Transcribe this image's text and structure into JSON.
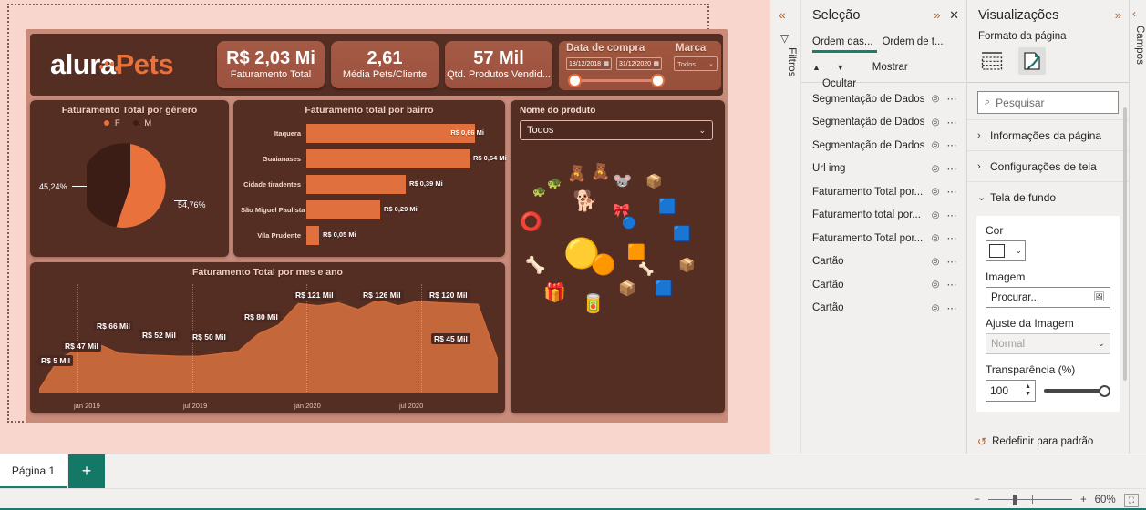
{
  "report": {
    "brand": {
      "name_left": "alura",
      "name_right": "Pets"
    },
    "kpis": [
      {
        "value": "R$ 2,03 Mi",
        "label": "Faturamento Total"
      },
      {
        "value": "2,61",
        "label": "Média Pets/Cliente"
      },
      {
        "value": "57 Mil",
        "label": "Qtd. Produtos Vendid..."
      }
    ],
    "slicers": {
      "date_title": "Data de compra",
      "date_start": "18/12/2018",
      "date_end": "31/12/2020",
      "brand_title": "Marca",
      "brand_value": "Todos"
    },
    "gallery": {
      "title": "Nome do produto",
      "selected": "Todos"
    }
  },
  "chart_data": [
    {
      "type": "pie",
      "title": "Faturamento Total por gênero",
      "legend": [
        "F",
        "M"
      ],
      "legend_position": "top",
      "categories": [
        "F",
        "M"
      ],
      "values": [
        54.76,
        45.24
      ],
      "labels": [
        "54,76%",
        "45,24%"
      ],
      "colors": [
        "#e8713c",
        "#3b1d16"
      ]
    },
    {
      "type": "bar",
      "title": "Faturamento total por bairro",
      "orientation": "horizontal",
      "categories": [
        "Itaquera",
        "Guaianases",
        "Cidade tiradentes",
        "São Miguel Paulista",
        "Vila Prudente"
      ],
      "values": [
        0.66,
        0.64,
        0.39,
        0.29,
        0.05
      ],
      "labels": [
        "R$ 0,66 Mi",
        "R$ 0,64 Mi",
        "R$ 0,39 Mi",
        "R$ 0,29 Mi",
        "R$ 0,05 Mi"
      ],
      "xlabel": "",
      "ylabel": "",
      "xlim": [
        0,
        0.7
      ],
      "color": "#e0713f"
    },
    {
      "type": "area",
      "title": "Faturamento Total por mes e ano",
      "xlabel": "",
      "ylabel": "",
      "x_ticks": [
        "jan 2019",
        "jul 2019",
        "jan 2020",
        "jul 2020"
      ],
      "ylim": [
        0,
        135
      ],
      "grid": true,
      "color": "#d26a38",
      "labeled_points": [
        {
          "label": "R$ 5 Mil",
          "value": 5
        },
        {
          "label": "R$ 47 Mil",
          "value": 47
        },
        {
          "label": "R$ 66 Mil",
          "value": 66
        },
        {
          "label": "R$ 52 Mil",
          "value": 52
        },
        {
          "label": "R$ 50 Mil",
          "value": 50
        },
        {
          "label": "R$ 80 Mil",
          "value": 80
        },
        {
          "label": "R$ 121 Mil",
          "value": 121
        },
        {
          "label": "R$ 126 Mil",
          "value": 126
        },
        {
          "label": "R$ 120 Mil",
          "value": 120
        },
        {
          "label": "R$ 45 Mil",
          "value": 45
        }
      ],
      "values": [
        5,
        47,
        60,
        66,
        54,
        52,
        51,
        50,
        50,
        53,
        57,
        80,
        92,
        121,
        118,
        122,
        113,
        126,
        118,
        124,
        122,
        121,
        120,
        45
      ]
    }
  ],
  "filters_rail": {
    "label": "Filtros",
    "collapse_icon": "«",
    "filter_icon": "filter"
  },
  "selection_pane": {
    "title": "Seleção",
    "expand_icon": "»",
    "close_icon": "✕",
    "tabs": [
      "Ordem das...",
      "Ordem de t..."
    ],
    "show_label": "Mostrar",
    "hide_label": "Ocultar",
    "up_arrow": "▲",
    "down_arrow": "▼",
    "items": [
      "Segmentação de Dados",
      "Segmentação de Dados",
      "Segmentação de Dados",
      "Url img",
      "Faturamento Total por...",
      "Faturamento total por...",
      "Faturamento Total por...",
      "Cartão",
      "Cartão",
      "Cartão"
    ],
    "eye_icon": "◎",
    "more_icon": "⋯"
  },
  "visualizations_pane": {
    "title": "Visualizações",
    "expand_icon": "»",
    "subtitle": "Formato da página",
    "tab_icons": [
      "page-layout-icon",
      "page-format-icon"
    ],
    "search_placeholder": "Pesquisar",
    "sections": [
      {
        "label": "Informações da página",
        "expanded": false,
        "twisty": "›"
      },
      {
        "label": "Configurações de tela",
        "expanded": false,
        "twisty": "›"
      },
      {
        "label": "Tela de fundo",
        "expanded": true,
        "twisty": "⌄"
      }
    ],
    "background": {
      "color_label": "Cor",
      "color_value": "#ffffff",
      "image_label": "Imagem",
      "image_button": "Procurar...",
      "fit_label": "Ajuste da Imagem",
      "fit_value": "Normal",
      "transparency_label": "Transparência (%)",
      "transparency_value": "100"
    },
    "reset_label": "Redefinir para padrão"
  },
  "fields_rail": {
    "label": "Campos",
    "collapse_icon": "‹"
  },
  "tabbar": {
    "page_tab": "Página 1",
    "add_icon": "+"
  },
  "statusbar": {
    "zoom_out": "−",
    "zoom_in": "+",
    "zoom_level": "60%",
    "fit_icon": "⛶"
  },
  "colors": {
    "canvas_bg": "#f8d5cd",
    "report_bg": "#c98b7a",
    "card_bg": "#542d23",
    "accent_orange": "#e8713c",
    "teal": "#167f6e"
  }
}
